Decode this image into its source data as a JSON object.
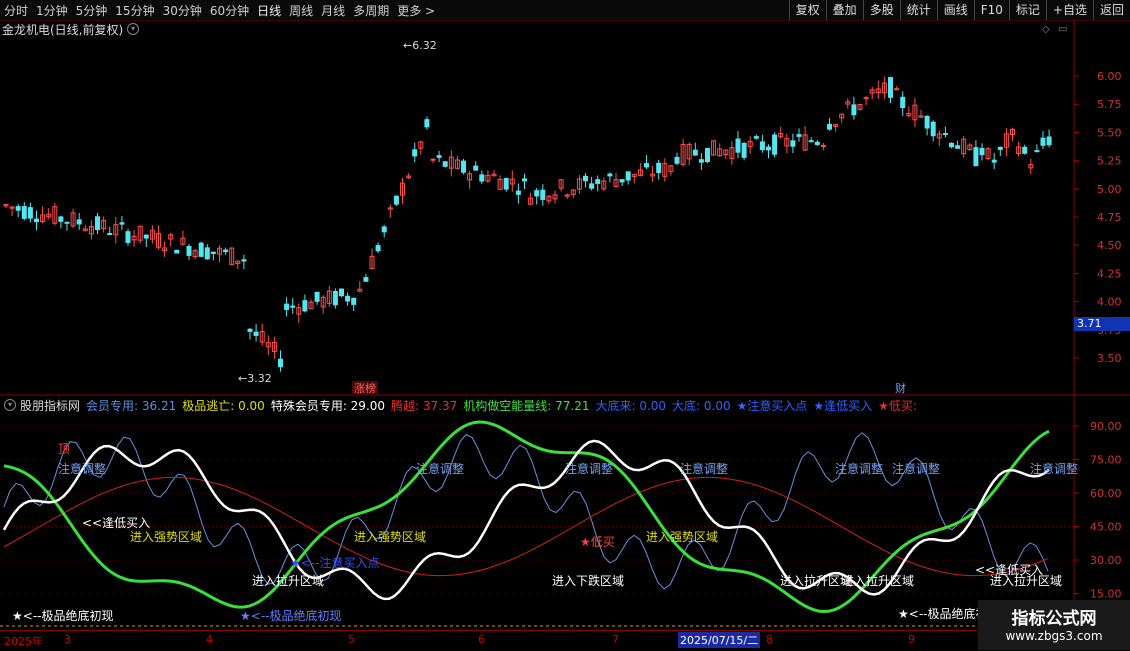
{
  "toolbar": {
    "timeframes": [
      "分时",
      "1分钟",
      "5分钟",
      "15分钟",
      "30分钟",
      "60分钟",
      "日线",
      "周线",
      "月线",
      "多周期",
      "更多 >"
    ],
    "active": "日线",
    "right_buttons": [
      "复权",
      "叠加",
      "多股",
      "统计",
      "画线",
      "F10",
      "标记",
      "+自选",
      "返回"
    ]
  },
  "chart_title": "金龙机电(日线,前复权)",
  "price_axis": [
    "6.00",
    "5.75",
    "5.50",
    "5.25",
    "5.00",
    "4.75",
    "4.50",
    "4.25",
    "4.00",
    "3.75",
    "3.50"
  ],
  "current_price": "3.71",
  "high_label": "6.32",
  "low_label": "3.32",
  "markers": {
    "zhangbang": "涨榜",
    "cai": "财"
  },
  "indicator_header": {
    "name": "股朋指标网",
    "items": [
      {
        "label": "会员专用:",
        "value": "36.21",
        "color": "#5b8fe0"
      },
      {
        "label": "极品逃亡:",
        "value": "0.00",
        "color": "#e0e000"
      },
      {
        "label": "特殊会员专用:",
        "value": "29.00",
        "color": "#ffffff"
      },
      {
        "label": "腾越:",
        "value": "37.37",
        "color": "#e03030"
      },
      {
        "label": "机构做空能量线:",
        "value": "77.21",
        "color": "#40e040"
      },
      {
        "label": "大底来:",
        "value": "0.00",
        "color": "#3060ff"
      },
      {
        "label": "大底:",
        "value": "0.00",
        "color": "#3060ff"
      },
      {
        "label": "★注意买入点",
        "value": "",
        "color": "#3060ff"
      },
      {
        "label": "★逢低买入",
        "value": "",
        "color": "#3060ff"
      },
      {
        "label": "★低买:",
        "value": "",
        "color": "#e03030"
      }
    ]
  },
  "indicator_axis": [
    "90.00",
    "75.00",
    "60.00",
    "45.00",
    "30.00",
    "15.00"
  ],
  "annotations": {
    "ding": "顶",
    "zhuyi": "注意调整",
    "fengdi": "<<逢低买入",
    "qiangshi": "进入强势区域",
    "lasheng": "进入拉升区域",
    "jipin": "★<--极品绝底初现",
    "zhuyimairu": "★<--注意买入点",
    "dimai": "★低买",
    "xiadie": "进入下跌区域"
  },
  "date_axis": {
    "year": "2025年",
    "months": [
      "3",
      "4",
      "5",
      "6",
      "7",
      "8",
      "9"
    ],
    "selected_date": "2025/07/15/二"
  },
  "watermark": {
    "line1": "指标公式网",
    "line2": "www.zbgs3.com"
  }
}
